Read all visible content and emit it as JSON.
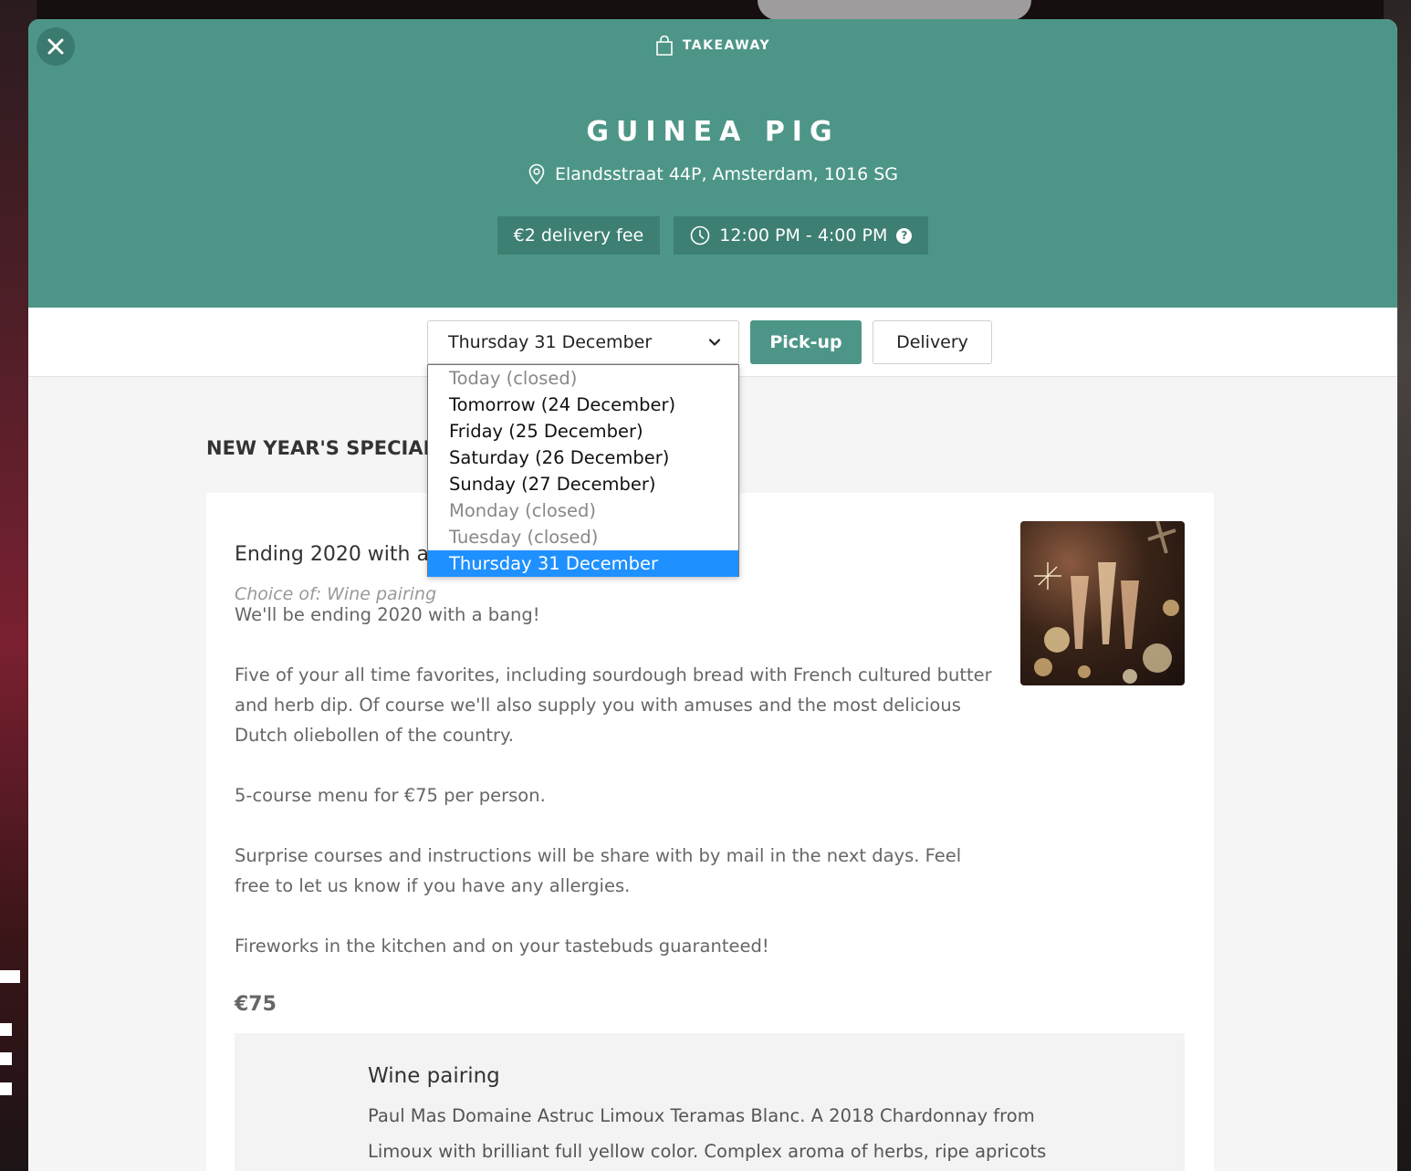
{
  "header": {
    "service_type": "TAKEAWAY",
    "restaurant_name": "GUINEA PIG",
    "address": "Elandsstraat 44P, Amsterdam, 1016 SG",
    "delivery_fee": "€2 delivery fee",
    "opening_hours": "12:00 PM - 4:00 PM",
    "help_glyph": "?",
    "colors": {
      "primary": "#4d9687",
      "badge": "#3d7f72"
    }
  },
  "toolbar": {
    "selected_date": "Thursday 31 December",
    "pickup_label": "Pick-up",
    "delivery_label": "Delivery"
  },
  "dropdown": {
    "options": [
      {
        "label": "Today (closed)",
        "state": "disabled"
      },
      {
        "label": "Tomorrow (24 December)",
        "state": "enabled"
      },
      {
        "label": "Friday (25 December)",
        "state": "enabled"
      },
      {
        "label": "Saturday (26 December)",
        "state": "enabled"
      },
      {
        "label": "Sunday (27 December)",
        "state": "enabled"
      },
      {
        "label": "Monday (closed)",
        "state": "disabled"
      },
      {
        "label": "Tuesday (closed)",
        "state": "disabled"
      },
      {
        "label": "Thursday 31 December",
        "state": "selected"
      }
    ],
    "selected_color": "#1e90ff"
  },
  "menu": {
    "section_title": "NEW YEAR'S SPECIAL",
    "item": {
      "title": "Ending 2020 with a",
      "choice": "Choice of: Wine pairing",
      "description": [
        "We'll be ending 2020 with a bang!",
        "Five of your all time favorites, including sourdough bread with French cultured butter and herb dip. Of course we'll also supply you with amuses and the most delicious Dutch oliebollen of the country.",
        "5-course menu for €75 per person.",
        "Surprise courses and instructions will be share with by mail in the next days. Feel free to let us know if you have any allergies.",
        "Fireworks in the kitchen and on your tastebuds guaranteed!"
      ],
      "price": "€75",
      "image_icon": "champagne-photo"
    },
    "option": {
      "title": "Wine pairing",
      "description": "Paul Mas Domaine Astruc Limoux Teramas Blanc. A 2018 Chardonnay from Limoux with brilliant full yellow color. Complex aroma of herbs, ripe apricots"
    }
  }
}
